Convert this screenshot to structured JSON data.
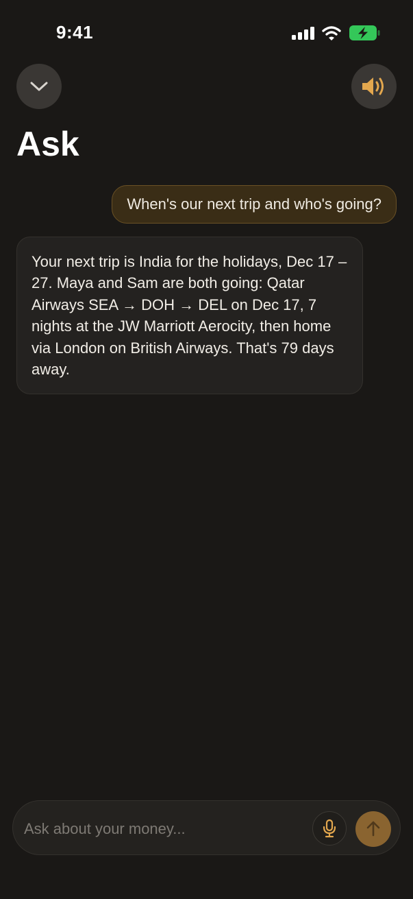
{
  "status_bar": {
    "time": "9:41",
    "icons": [
      "cellular-signal-icon",
      "wifi-icon",
      "battery-charging-icon"
    ],
    "battery_color": "#34c759"
  },
  "header": {
    "collapse_icon": "chevron-down-icon",
    "speaker_icon": "speaker-volume-icon",
    "title": "Ask"
  },
  "conversation": {
    "user_message": "When's our next trip and who's going?",
    "assistant_message": "Your next trip is India for the holidays, Dec 17 – 27. Maya and Sam are both going: Qatar Airways SEA → DOH → DEL on Dec 17, 7 nights at the JW Marriott Aerocity, then home via London on British Airways. That's 79 days away."
  },
  "composer": {
    "placeholder": "Ask about your money...",
    "value": "",
    "mic_icon": "microphone-icon",
    "send_icon": "arrow-up-icon"
  },
  "colors": {
    "background": "#1a1816",
    "accent": "#e3a74e",
    "user_bubble_bg": "#3a2d16",
    "user_bubble_border": "#6a5125",
    "send_button": "#8a6430"
  }
}
